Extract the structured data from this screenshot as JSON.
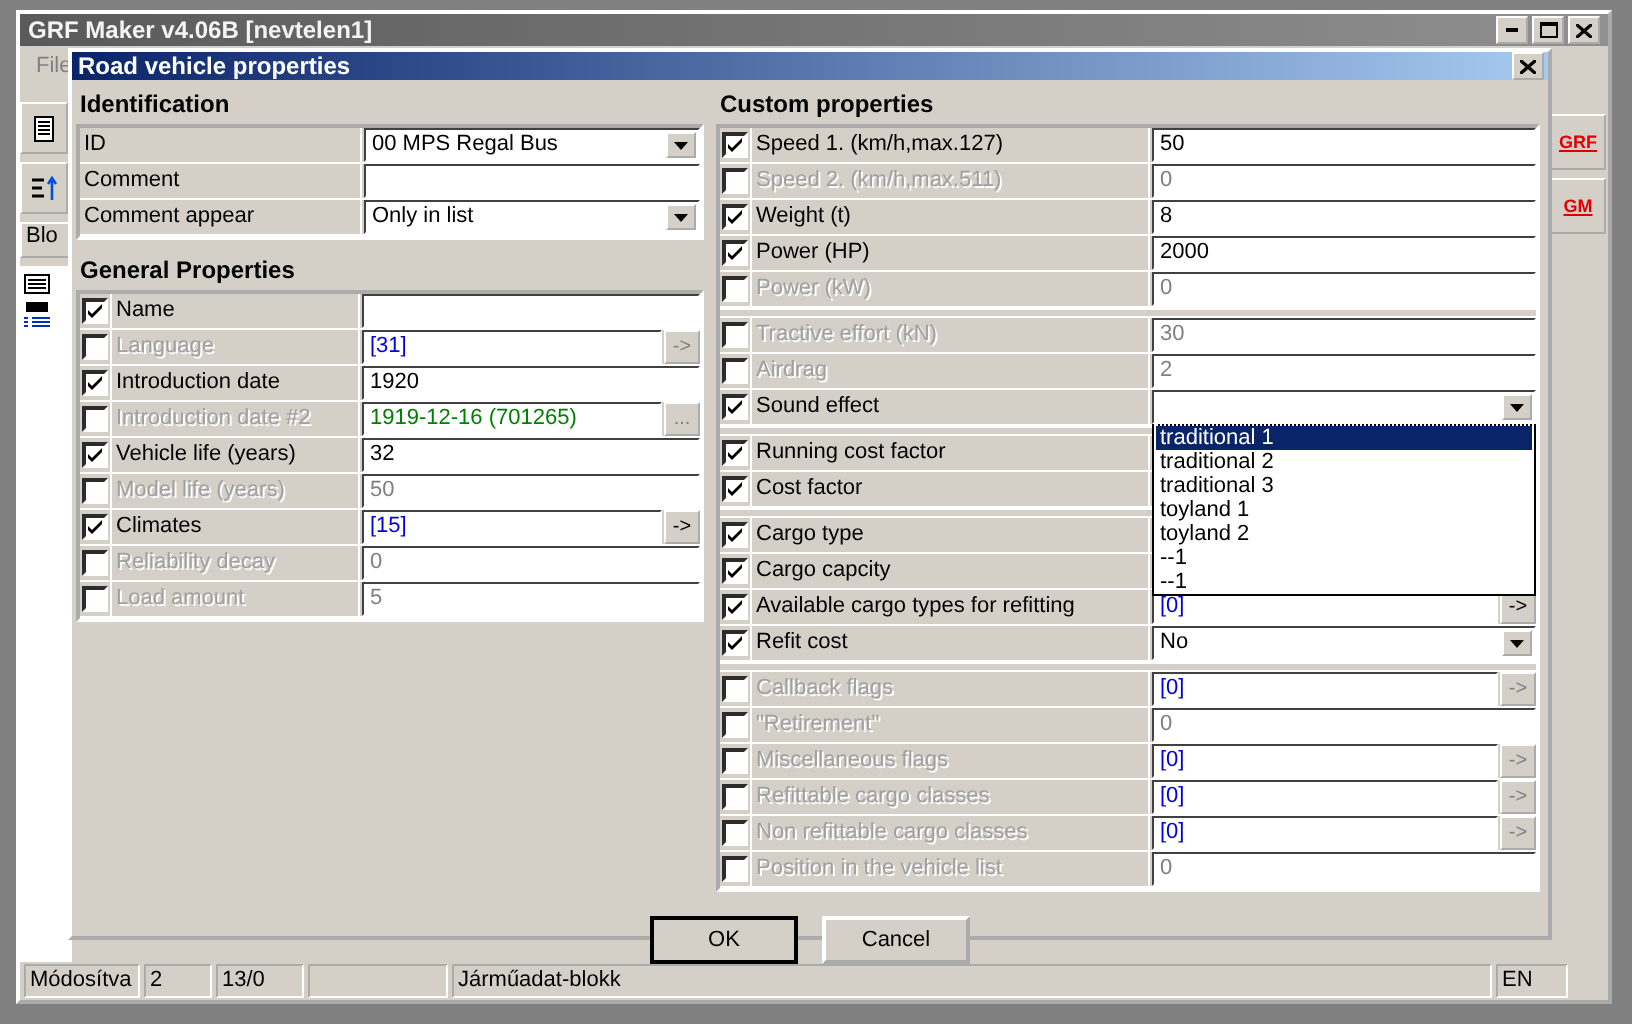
{
  "main_window": {
    "title": "GRF Maker v4.06B [nevtelen1]",
    "menu": [
      "File"
    ],
    "tab": "Blo",
    "side_buttons": [
      "GRF",
      "GM"
    ],
    "status_bar": [
      {
        "text": "Módosítva"
      },
      {
        "text": "2"
      },
      {
        "text": "13/0",
        "blank_after": true
      },
      {
        "text": "Járműadat-blokk"
      },
      {
        "text": "EN"
      }
    ]
  },
  "dialog": {
    "title": "Road vehicle properties",
    "left_sections": [
      {
        "title": "Identification",
        "groups": [
          [
            {
              "label": "ID",
              "kind": "combo",
              "value": "00 MPS Regal Bus"
            },
            {
              "label": "Comment",
              "kind": "text"
            },
            {
              "label": "Comment appear",
              "kind": "combo",
              "value": "Only in list"
            }
          ]
        ]
      },
      {
        "title": "General Properties",
        "groups": [
          [
            {
              "label": "Name",
              "kind": "text",
              "checked": true
            },
            {
              "label": "Language",
              "kind": "list",
              "checked": false,
              "value": "[31]",
              "button": "->"
            },
            {
              "label": "Introduction date",
              "kind": "text",
              "checked": true,
              "value": "1920"
            },
            {
              "label": "Introduction date #2",
              "kind": "date",
              "checked": false,
              "value": "1919-12-16  (701265)",
              "button": "..."
            },
            {
              "label": "Vehicle life  (years)",
              "kind": "text",
              "checked": true,
              "value": "32"
            },
            {
              "label": "Model life  (years)",
              "kind": "text",
              "checked": false,
              "value": "50"
            },
            {
              "label": "Climates",
              "kind": "list",
              "checked": true,
              "value": "[15]",
              "button": "->"
            },
            {
              "label": "Reliability decay",
              "kind": "text",
              "checked": false,
              "value": "0"
            },
            {
              "label": "Load amount",
              "kind": "text",
              "checked": false,
              "value": "5"
            }
          ]
        ]
      }
    ],
    "right_sections": [
      {
        "title": "Custom properties",
        "groups": [
          [
            {
              "label": "Speed 1. (km/h,max.127)",
              "kind": "text",
              "checked": true,
              "value": "50"
            },
            {
              "label": "Speed 2.  (km/h,max.511)",
              "kind": "text",
              "checked": false,
              "value": "0"
            },
            {
              "label": "Weight  (t)",
              "kind": "text",
              "checked": true,
              "value": "8"
            },
            {
              "label": "Power  (HP)",
              "kind": "text",
              "checked": true,
              "value": "2000"
            },
            {
              "label": "Power  (kW)",
              "kind": "text",
              "checked": false,
              "value": "0"
            }
          ],
          [
            {
              "label": "Tractive effort  (kN)",
              "kind": "text",
              "checked": false,
              "value": "30"
            },
            {
              "label": "Airdrag",
              "kind": "text",
              "checked": false,
              "value": "2"
            },
            {
              "label": "Sound effect",
              "kind": "combo",
              "checked": true,
              "expanded": true,
              "options": [
                {
                  "label": "traditional 1",
                  "selected": true
                },
                {
                  "label": "traditional 2",
                  "selected": false
                },
                {
                  "label": "traditional 3",
                  "selected": false
                },
                {
                  "label": "toyland 1",
                  "selected": false
                },
                {
                  "label": "toyland 2",
                  "selected": false
                },
                {
                  "label": "--1",
                  "selected": false
                },
                {
                  "label": "--1",
                  "selected": false
                }
              ]
            }
          ],
          [
            {
              "label": "Running cost factor",
              "kind": "text",
              "checked": true
            },
            {
              "label": "Cost factor",
              "kind": "text",
              "checked": true
            }
          ],
          [
            {
              "label": "Cargo type",
              "kind": "text",
              "checked": true
            },
            {
              "label": "Cargo capcity",
              "kind": "text",
              "checked": true
            },
            {
              "label": "Available cargo types for refitting",
              "kind": "list",
              "checked": true,
              "value": "[0]",
              "button": "->"
            },
            {
              "label": "Refit cost",
              "kind": "combo",
              "checked": true,
              "value": "No"
            }
          ],
          [
            {
              "label": "Callback flags",
              "kind": "list",
              "checked": false,
              "value": "[0]",
              "button": "->"
            },
            {
              "label": "\"Retirement\"",
              "kind": "text",
              "checked": false,
              "value": "0"
            },
            {
              "label": "Miscellaneous flags",
              "kind": "list",
              "checked": false,
              "value": "[0]",
              "button": "->"
            },
            {
              "label": "Refittable cargo classes",
              "kind": "list",
              "checked": false,
              "value": "[0]",
              "button": "->"
            },
            {
              "label": "Non refittable cargo classes",
              "kind": "list",
              "checked": false,
              "value": "[0]",
              "button": "->"
            },
            {
              "label": "Position in the vehicle list",
              "kind": "text",
              "checked": false,
              "value": "0"
            }
          ]
        ]
      }
    ],
    "buttons": [
      {
        "label": "OK",
        "default": true
      },
      {
        "label": "Cancel",
        "default": false
      }
    ]
  }
}
